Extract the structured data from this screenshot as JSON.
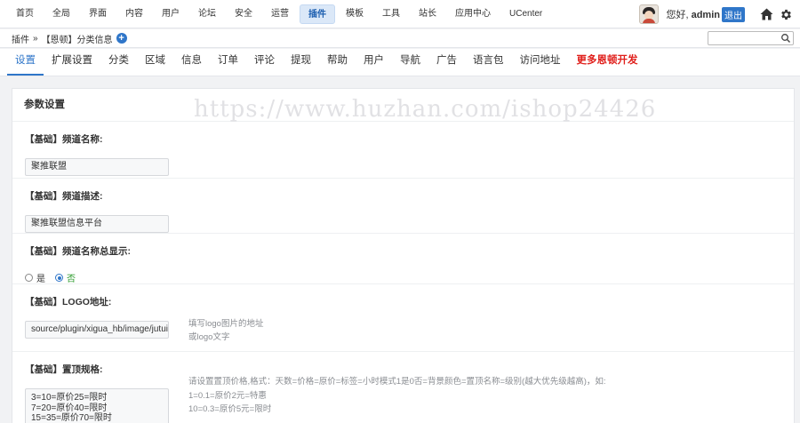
{
  "topnav": {
    "items": [
      "首页",
      "全局",
      "界面",
      "内容",
      "用户",
      "论坛",
      "安全",
      "运营",
      "插件",
      "模板",
      "工具",
      "站长",
      "应用中心",
      "UCenter"
    ],
    "active_index": 8
  },
  "user": {
    "greeting_prefix": "您好, ",
    "name": "admin",
    "logout_label": "退出"
  },
  "breadcrumb": {
    "root": "插件",
    "separator": "»",
    "current": "【恩顿】分类信息"
  },
  "search": {
    "value": ""
  },
  "tabs": {
    "items": [
      "设置",
      "扩展设置",
      "分类",
      "区域",
      "信息",
      "订单",
      "评论",
      "提现",
      "帮助",
      "用户",
      "导航",
      "广告",
      "语言包",
      "访问地址"
    ],
    "more": "更多恩顿开发",
    "active_index": 0
  },
  "panel": {
    "title": "参数设置",
    "fields": {
      "channel_name": {
        "label": "【基础】频道名称:",
        "value": "聚推联盟"
      },
      "channel_desc": {
        "label": "【基础】频道描述:",
        "value": "聚推联盟信息平台"
      },
      "show_name": {
        "label": "【基础】频道名称总显示:",
        "option_yes": "是",
        "option_no": "否",
        "selected": "否"
      },
      "logo": {
        "label": "【基础】LOGO地址:",
        "value": "source/plugin/xigua_hb/image/jutuilo",
        "hint_line1": "填写logo图片的地址",
        "hint_line2": "或logo文字"
      },
      "top_rules": {
        "label": "【基础】置顶规格:",
        "lines": [
          "3=10=原价25=限时",
          "7=20=原价40=限时",
          "15=35=原价70=限时"
        ],
        "hint_line1": "请设置置顶价格,格式：天数=价格=原价=标签=小时模式1是0否=背景颜色=置顶名称=级别(越大优先级越高)，如:",
        "hint_line2": "1=0.1=原价2元=特惠",
        "hint_line3": "10=0.3=原价5元=限时"
      }
    }
  },
  "watermark": "https://www.huzhan.com/ishop24426",
  "colors": {
    "accent": "#2f76c9",
    "more_link": "#e0201c",
    "active_nav_bg": "#dbe8f8"
  }
}
